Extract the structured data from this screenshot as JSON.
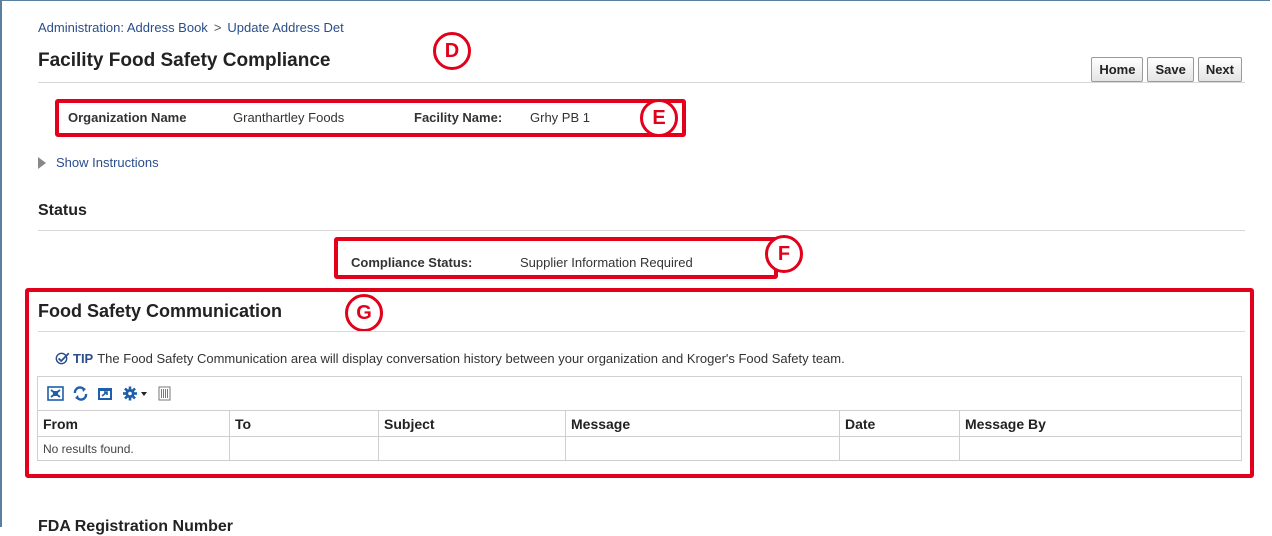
{
  "breadcrumb": {
    "item1": "Administration: Address Book",
    "separator": ">",
    "item2": "Update Address Det"
  },
  "page": {
    "title": "Facility Food Safety Compliance"
  },
  "actions": {
    "home": "Home",
    "save": "Save",
    "next": "Next"
  },
  "org": {
    "org_label": "Organization Name",
    "org_value": "Granthartley Foods",
    "facility_label": "Facility Name:",
    "facility_value": "Grhy PB 1"
  },
  "instructions": {
    "toggle_label": "Show Instructions"
  },
  "status": {
    "heading": "Status",
    "compliance_label": "Compliance Status:",
    "compliance_value": "Supplier Information Required"
  },
  "communication": {
    "heading": "Food Safety Communication",
    "tip_label": "TIP",
    "tip_text": "The Food Safety Communication area will display conversation history between your organization and Kroger's Food Safety team.",
    "columns": [
      "From",
      "To",
      "Subject",
      "Message",
      "Date",
      "Message By"
    ],
    "empty_text": "No results found."
  },
  "fda": {
    "heading": "FDA Registration Number"
  },
  "callouts": {
    "d": "D",
    "e": "E",
    "f": "F",
    "g": "G"
  },
  "colors": {
    "accent_red": "#e2001a",
    "link_blue": "#2a4e8b",
    "icon_blue": "#1f5ea8"
  }
}
